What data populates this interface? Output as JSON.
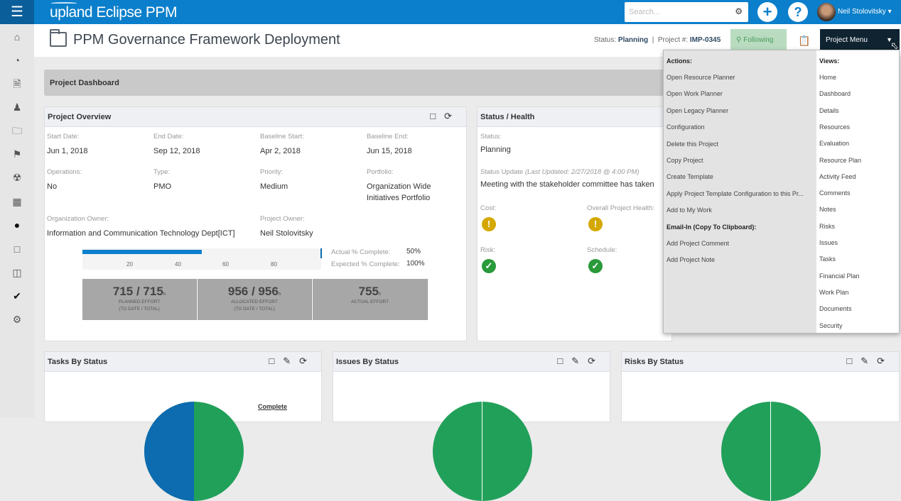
{
  "app": {
    "logo": "upland Eclipse PPM",
    "search_placeholder": "Search...",
    "user": "Neil Stolovitsky"
  },
  "icons": [
    "menu-icon",
    "home-icon",
    "dashboard-icon",
    "document-clock-icon",
    "people-icon",
    "folder-icon",
    "flag-icon",
    "radiation-icon",
    "calculator-icon",
    "person-icon",
    "note-icon",
    "report-icon",
    "check-icon",
    "gear-icon"
  ],
  "header": {
    "title": "PPM Governance Framework Deployment",
    "status_label": "Status:",
    "status": "Planning",
    "project_label": "Project #:",
    "project_id": "IMP-0345",
    "following": "Following",
    "project_menu": "Project Menu"
  },
  "dashboard": {
    "title": "Project Dashboard"
  },
  "overview": {
    "title": "Project Overview",
    "fields": [
      {
        "label": "Start Date:",
        "value": "Jun 1, 2018"
      },
      {
        "label": "End Date:",
        "value": "Sep 12, 2018"
      },
      {
        "label": "Baseline Start:",
        "value": "Apr 2, 2018"
      },
      {
        "label": "Baseline End:",
        "value": "Jun 15, 2018"
      },
      {
        "label": "Operations:",
        "value": "No"
      },
      {
        "label": "Type:",
        "value": "PMO"
      },
      {
        "label": "Priority:",
        "value": "Medium"
      },
      {
        "label": "Portfolio:",
        "value": "Organization Wide Initiatives Portfolio"
      },
      {
        "label": "Organization Owner:",
        "value": "Information and Communication Technology Dept[ICT]"
      },
      {
        "label": "Project Owner:",
        "value": "Neil Stolovitsky"
      }
    ],
    "progress": {
      "actual_percent": 50,
      "expected_percent": 100,
      "ticks": [
        "20",
        "40",
        "60",
        "80"
      ],
      "actual_label": "Actual % Complete:",
      "actual": "50%",
      "expected_label": "Expected % Complete:",
      "expected": "100%"
    },
    "effort": [
      {
        "value": "715 / 715",
        "unit": "h",
        "label1": "PLANNED EFFORT",
        "label2": "(TO DATE / TOTAL)"
      },
      {
        "value": "956 / 956",
        "unit": "h",
        "label1": "ALLOCATED EFFORT",
        "label2": "(TO DATE / TOTAL)"
      },
      {
        "value": "755",
        "unit": "h",
        "label1": "ACTUAL EFFORT",
        "label2": ""
      }
    ]
  },
  "health": {
    "title": "Status / Health",
    "status_label": "Status:",
    "status": "Planning",
    "update_label": "Status Update",
    "update_meta": "(Last Updated: 2/27/2018 @ 4:00 PM)",
    "update_text": "Meeting with the stakeholder committee has taken",
    "cost_label": "Cost:",
    "overall_label": "Overall Project Health:",
    "risk_label": "Risk:",
    "schedule_label": "Schedule:",
    "colors": {
      "warning": "#d4a800",
      "ok": "#2a9a3a"
    }
  },
  "menu": {
    "actions_header": "Actions:",
    "actions": [
      "Open Resource Planner",
      "Open Work Planner",
      "Open Legacy Planner",
      "Configuration",
      "Delete this Project",
      "Copy Project",
      "Create Template",
      "Apply Project Template Configuration to this Pr...",
      "Add to My Work"
    ],
    "email_header": "Email-In (Copy To Clipboard):",
    "email": [
      "Add Project Comment",
      "Add Project Note"
    ],
    "views_header": "Views:",
    "views": [
      "Home",
      "Dashboard",
      "Details",
      "Resources",
      "Evaluation",
      "Resource Plan",
      "Activity Feed",
      "Comments",
      "Notes",
      "Risks",
      "Issues",
      "Tasks",
      "Financial Plan",
      "Work Plan",
      "Documents",
      "Security"
    ]
  },
  "widgets": [
    {
      "title": "Tasks By Status",
      "legend": "Complete"
    },
    {
      "title": "Issues By Status"
    },
    {
      "title": "Risks By Status"
    }
  ],
  "colors": {
    "brand": "#0b7fcb",
    "pie_green": "#21a05a",
    "pie_blue": "#0d6bb0"
  }
}
